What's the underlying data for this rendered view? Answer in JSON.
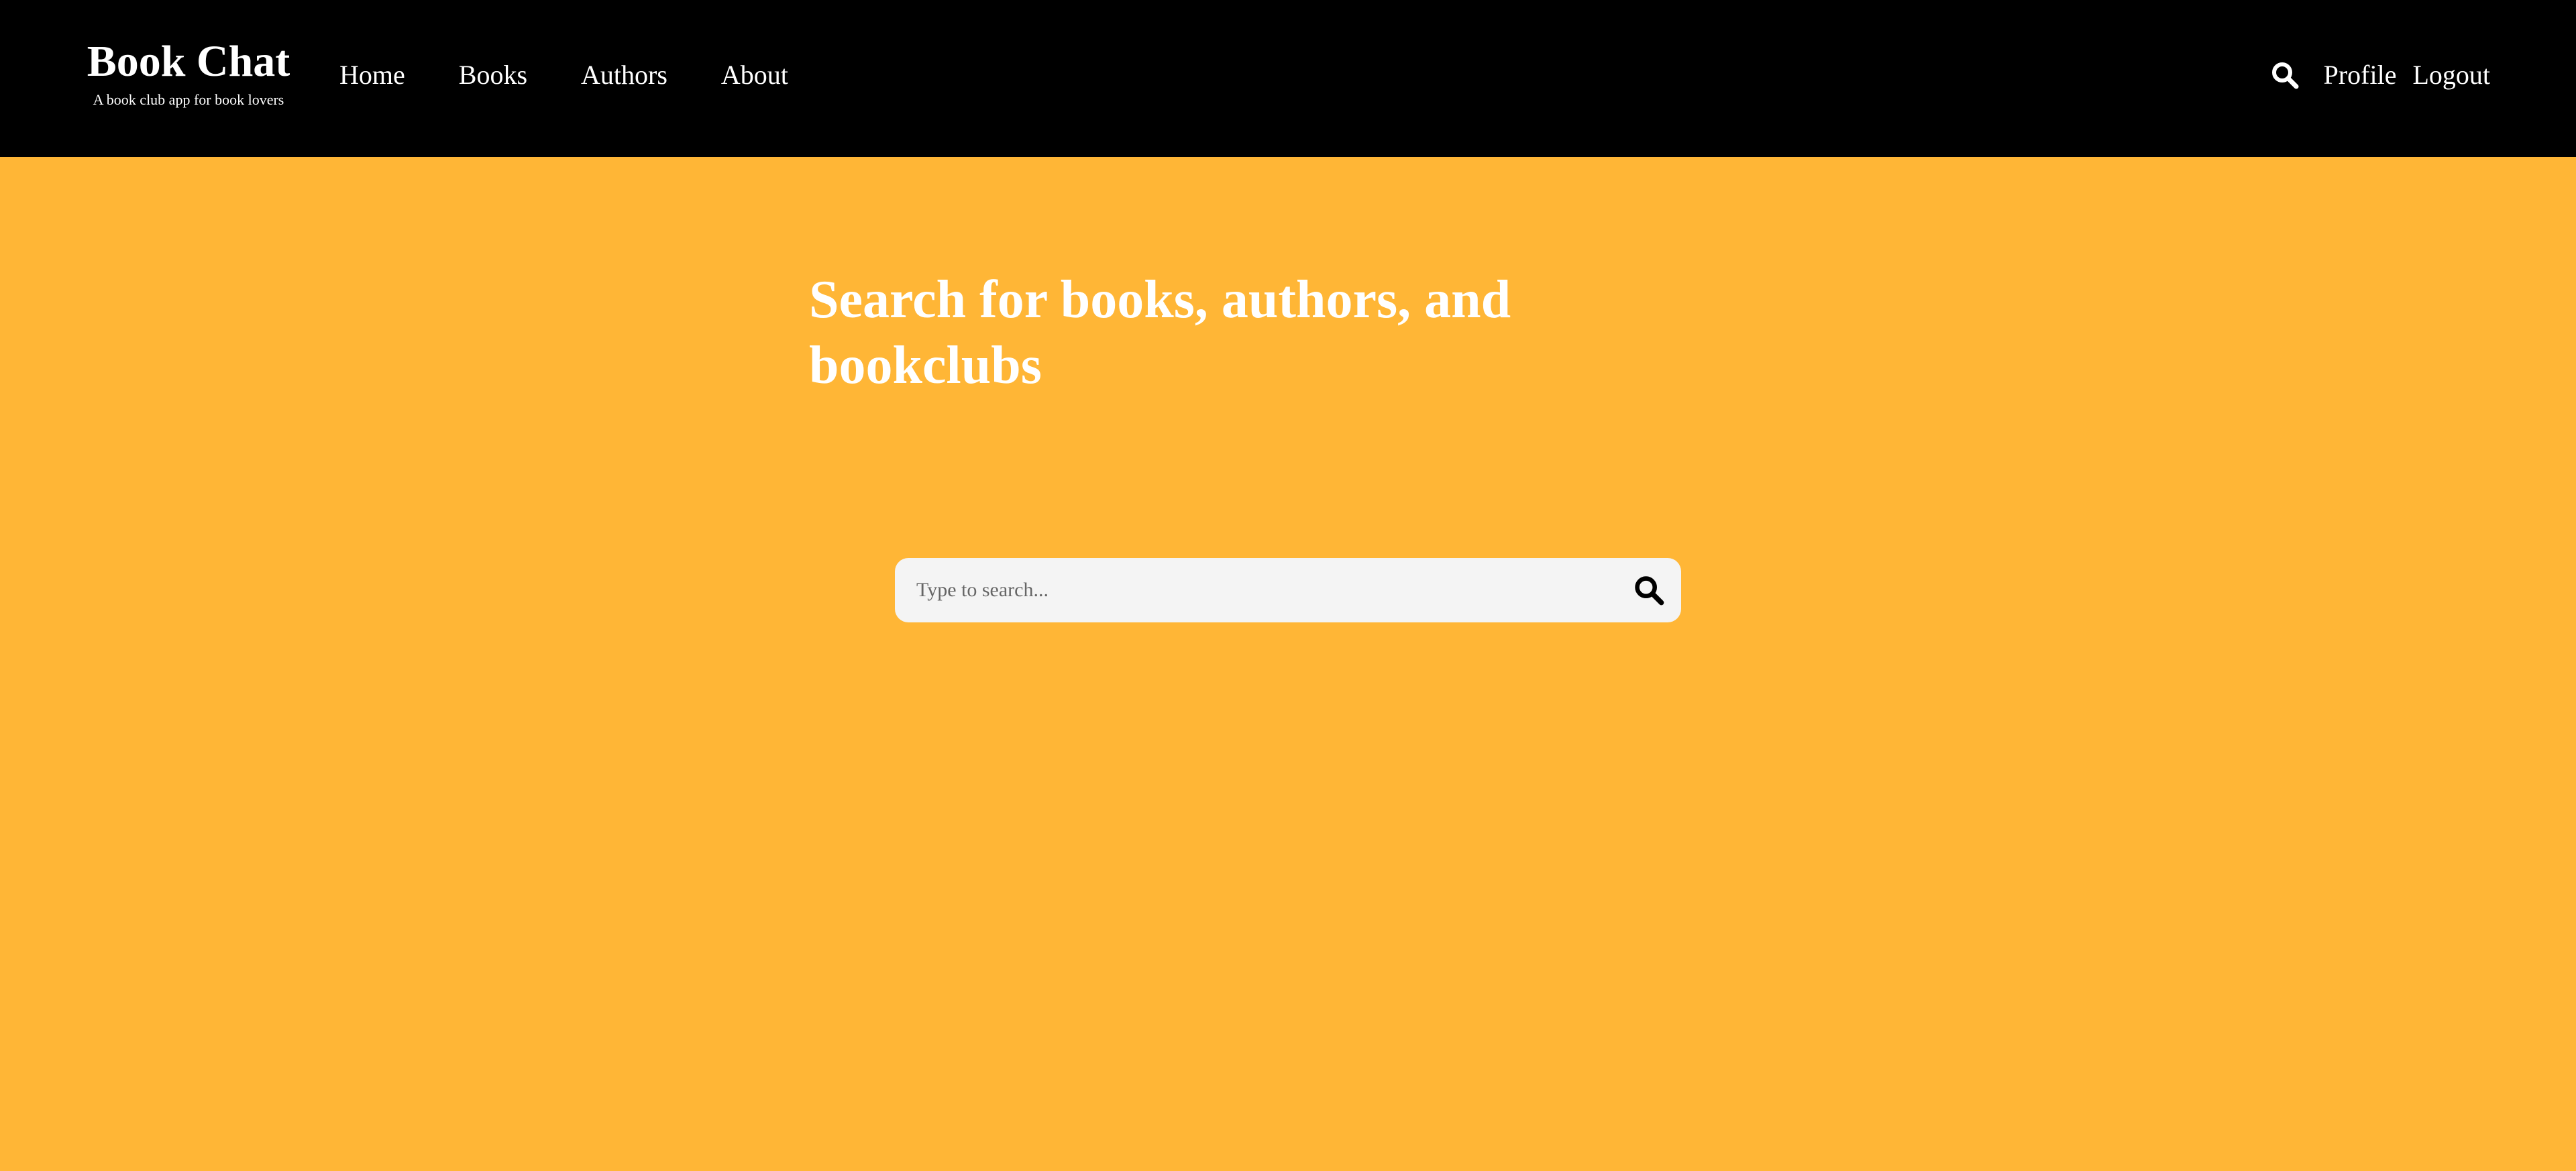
{
  "brand": {
    "title": "Book Chat",
    "subtitle": "A book club app for book lovers"
  },
  "nav": {
    "links": [
      {
        "label": "Home"
      },
      {
        "label": "Books"
      },
      {
        "label": "Authors"
      },
      {
        "label": "About"
      }
    ],
    "search_icon": "search-icon",
    "profile_label": "Profile",
    "logout_label": "Logout"
  },
  "main": {
    "heading": "Search for books, authors, and bookclubs",
    "search": {
      "placeholder": "Type to search...",
      "value": "",
      "icon": "search-icon"
    }
  },
  "colors": {
    "navbar_bg": "#000000",
    "page_bg": "#ffb636",
    "text_light": "#ffffff",
    "search_bg": "#f4f4f4"
  }
}
